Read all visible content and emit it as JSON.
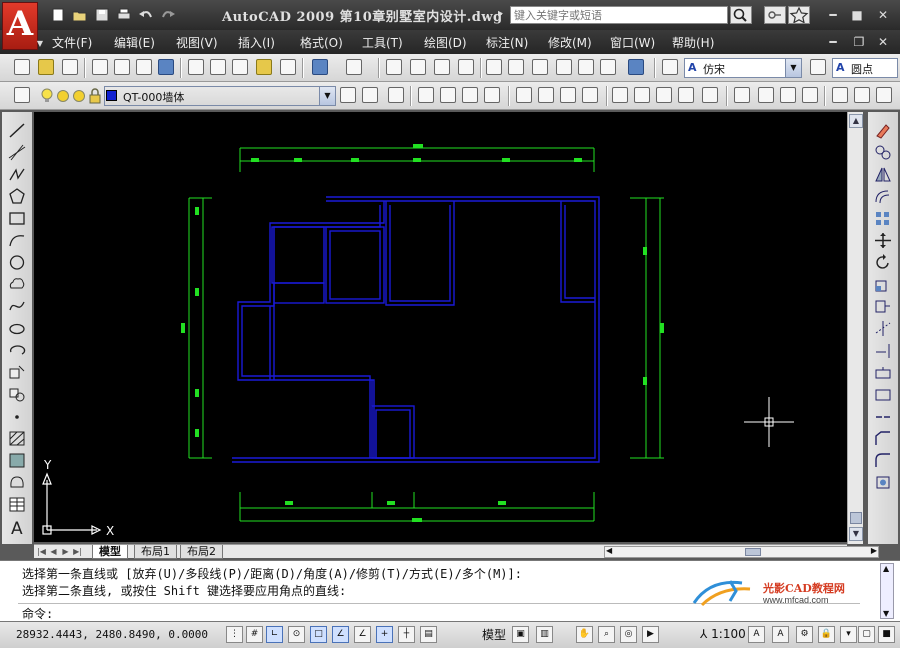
{
  "title_bar": {
    "app_logo": "A",
    "window_title": "AutoCAD 2009  第10章别墅室内设计.dwg",
    "search_placeholder": "键入关键字或短语",
    "window_buttons": [
      "minimize",
      "maximize",
      "close"
    ]
  },
  "menu_bar": {
    "items": [
      "文件(F)",
      "编辑(E)",
      "视图(V)",
      "插入(I)",
      "格式(O)",
      "工具(T)",
      "绘图(D)",
      "标注(N)",
      "修改(M)",
      "窗口(W)",
      "帮助(H)"
    ]
  },
  "toolbar1": {
    "text_style": "仿宋",
    "dim_style": "圆点"
  },
  "toolbar2": {
    "layer": "QT-000墙体"
  },
  "canvas": {
    "background": "#000000",
    "wall_color": "#1a1ad8",
    "dim_color": "#22e022",
    "ucs": {
      "x_label": "X",
      "y_label": "Y"
    }
  },
  "layout_tabs": {
    "tabs": [
      "模型",
      "布局1",
      "布局2"
    ],
    "active": "模型"
  },
  "command": {
    "history": [
      "选择第一条直线或 [放弃(U)/多段线(P)/距离(D)/角度(A)/修剪(T)/方式(E)/多个(M)]:",
      "选择第二条直线, 或按住 Shift 键选择要应用角点的直线:"
    ],
    "prompt": "命令:",
    "watermark": {
      "name": "光影CAD教程网",
      "url": "www.mfcad.com"
    }
  },
  "status_bar": {
    "coordinates": "28932.4443, 2480.8490, 0.0000",
    "model_label": "模型",
    "annotation_scale": "1:100"
  }
}
